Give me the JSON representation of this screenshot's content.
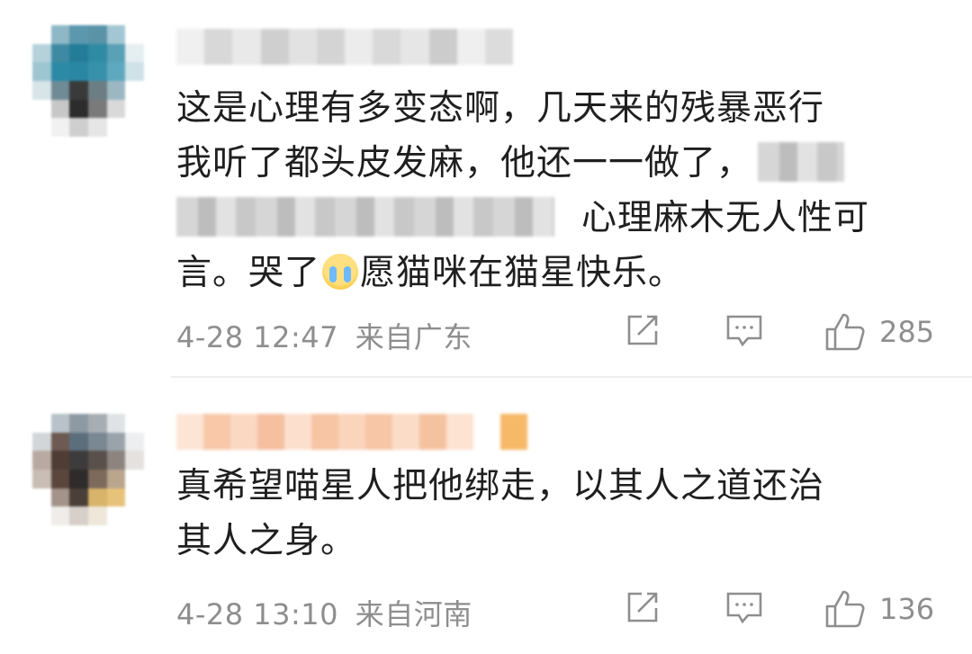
{
  "comments": [
    {
      "text": {
        "line1": "这是心理有多变态啊，几天来的残暴恶行",
        "line2": "我听了都头皮发麻，他还一一做了，",
        "line3_after_redaction": "心理麻木无人性可",
        "line4_part1": "言。哭了",
        "line4_part2": "愿猫咪在猫星快乐。"
      },
      "emoji": "crying-face-icon",
      "time": "4-28 12:47",
      "location": "来自广东",
      "likes": "285"
    },
    {
      "text": {
        "line1": "真希望喵星人把他绑走，以其人之道还治",
        "line2": "其人之身。"
      },
      "time": "4-28 13:10",
      "location": "来自河南",
      "likes": "136"
    }
  ],
  "icons": {
    "share": "share-edit-icon",
    "reply": "comment-bubble-icon",
    "like": "thumbs-up-icon"
  },
  "colors": {
    "text": "#1f1f1f",
    "meta": "#8e8e8e",
    "divider": "#eeeeee"
  }
}
